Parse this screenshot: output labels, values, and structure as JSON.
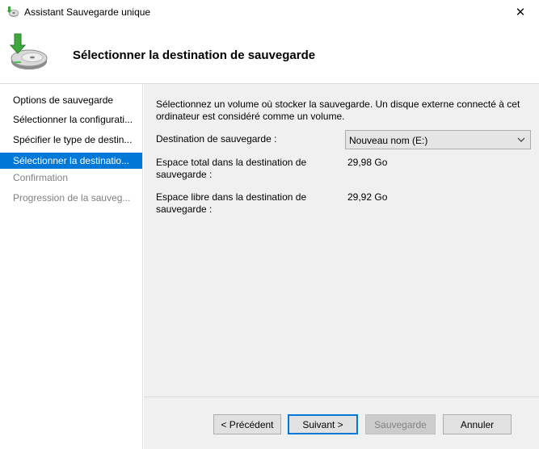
{
  "window": {
    "title": "Assistant Sauvegarde unique",
    "close_glyph": "✕"
  },
  "header": {
    "title": "Sélectionner la destination de sauvegarde",
    "icon": "backup-disk-icon"
  },
  "sidebar": {
    "items": [
      {
        "label": "Options de sauvegarde",
        "state": "normal"
      },
      {
        "label": "Sélectionner la configurati...",
        "state": "normal"
      },
      {
        "label": "Spécifier le type de destin...",
        "state": "normal"
      },
      {
        "label": "Sélectionner la destinatio...",
        "state": "active"
      },
      {
        "label": "Confirmation",
        "state": "disabled"
      },
      {
        "label": "Progression de la sauveg...",
        "state": "disabled"
      }
    ]
  },
  "main": {
    "intro": "Sélectionnez un volume où stocker la sauvegarde. Un disque externe connecté à cet ordinateur est considéré comme un volume.",
    "destination_label": "Destination de sauvegarde :",
    "destination_value": "Nouveau nom (E:)",
    "total_label": "Espace total dans la destination de sauvegarde :",
    "total_value": "29,98 Go",
    "free_label": "Espace libre dans la destination de sauvegarde :",
    "free_value": "29,92 Go"
  },
  "footer": {
    "previous_label": "< Précédent",
    "next_label": "Suivant >",
    "backup_label": "Sauvegarde",
    "cancel_label": "Annuler"
  },
  "colors": {
    "accent": "#0078d7",
    "panel": "#f0f0f0",
    "disabled_text": "#808080"
  }
}
